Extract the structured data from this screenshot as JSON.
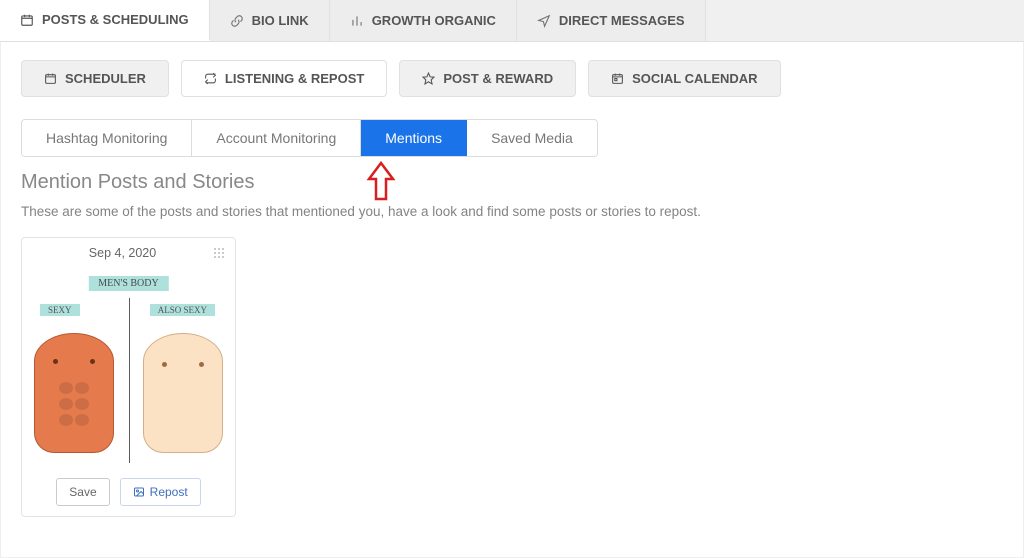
{
  "topTabs": [
    {
      "label": "POSTS & SCHEDULING",
      "icon": "calendar-icon",
      "active": true
    },
    {
      "label": "BIO LINK",
      "icon": "link-icon",
      "active": false
    },
    {
      "label": "GROWTH ORGANIC",
      "icon": "bar-chart-icon",
      "active": false
    },
    {
      "label": "DIRECT MESSAGES",
      "icon": "send-icon",
      "active": false
    }
  ],
  "secondaryTabs": [
    {
      "label": "SCHEDULER",
      "icon": "calendar-icon",
      "active": false
    },
    {
      "label": "LISTENING & REPOST",
      "icon": "repost-icon",
      "active": true
    },
    {
      "label": "POST & REWARD",
      "icon": "star-icon",
      "active": false
    },
    {
      "label": "SOCIAL CALENDAR",
      "icon": "calendar-square-icon",
      "active": false
    }
  ],
  "subTabs": [
    {
      "label": "Hashtag Monitoring",
      "active": false
    },
    {
      "label": "Account Monitoring",
      "active": false
    },
    {
      "label": "Mentions",
      "active": true
    },
    {
      "label": "Saved Media",
      "active": false
    }
  ],
  "section": {
    "title": "Mention Posts and Stories",
    "subtitle": "These are some of the posts and stories that mentioned you, have a look and find some posts or stories to repost."
  },
  "posts": [
    {
      "date": "Sep 4, 2020",
      "caption_banner": "MEN'S BODY",
      "caption_left": "SEXY",
      "caption_right": "ALSO SEXY",
      "saveLabel": "Save",
      "repostLabel": "Repost"
    }
  ]
}
